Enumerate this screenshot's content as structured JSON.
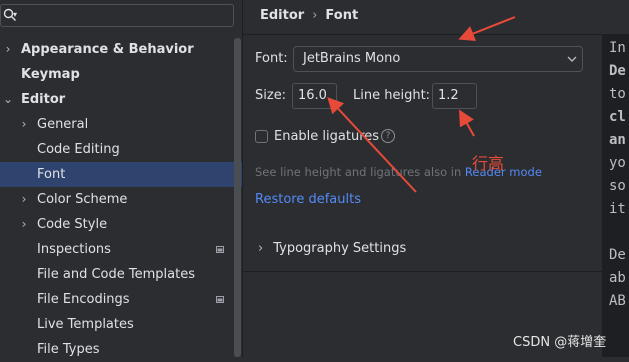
{
  "search": {
    "value": ""
  },
  "sidebar": {
    "items": [
      {
        "label": "Appearance & Behavior",
        "chevron": "›",
        "bold": true
      },
      {
        "label": "Keymap",
        "chevron": "",
        "bold": true
      },
      {
        "label": "Editor",
        "chevron": "⌄",
        "bold": true
      },
      {
        "label": "General",
        "chevron": "›",
        "bold": false
      },
      {
        "label": "Code Editing",
        "chevron": "",
        "bold": false
      },
      {
        "label": "Font",
        "chevron": "",
        "bold": false,
        "selected": true
      },
      {
        "label": "Color Scheme",
        "chevron": "›",
        "bold": false
      },
      {
        "label": "Code Style",
        "chevron": "›",
        "bold": false
      },
      {
        "label": "Inspections",
        "chevron": "",
        "bold": false,
        "project_icon": true
      },
      {
        "label": "File and Code Templates",
        "chevron": "",
        "bold": false
      },
      {
        "label": "File Encodings",
        "chevron": "",
        "bold": false,
        "project_icon": true
      },
      {
        "label": "Live Templates",
        "chevron": "",
        "bold": false
      },
      {
        "label": "File Types",
        "chevron": "",
        "bold": false
      }
    ]
  },
  "breadcrumb": {
    "parent": "Editor",
    "separator": "›",
    "current": "Font"
  },
  "font": {
    "label": "Font:",
    "value": "JetBrains Mono",
    "size_label": "Size:",
    "size_value": "16.0",
    "line_height_label": "Line height:",
    "line_height_value": "1.2",
    "ligatures_label": "Enable ligatures",
    "ligatures_checked": false,
    "help_glyph": "?",
    "hint_prefix": "See line height and ligatures also in ",
    "hint_link": "Reader mode",
    "restore_label": "Restore defaults",
    "typography_label": "Typography Settings",
    "typography_chevron": "›"
  },
  "preview_lines": [
    {
      "text": "In",
      "bold": false
    },
    {
      "text": "De",
      "bold": true
    },
    {
      "text": "to",
      "bold": false
    },
    {
      "text": "cl",
      "bold": true
    },
    {
      "text": "an",
      "bold": true
    },
    {
      "text": "yo",
      "bold": false
    },
    {
      "text": "so",
      "bold": false
    },
    {
      "text": "it",
      "bold": false
    },
    {
      "text": "",
      "bold": false
    },
    {
      "text": "De",
      "bold": false
    },
    {
      "text": "ab",
      "bold": false
    },
    {
      "text": "AB",
      "bold": false
    }
  ],
  "annotation": {
    "text": "行高",
    "color": "#e84a3a"
  },
  "watermark": "CSDN @蒋增奎",
  "colors": {
    "accent": "#548af7",
    "selection": "#2e436e",
    "annotation_red": "#e84a3a"
  }
}
